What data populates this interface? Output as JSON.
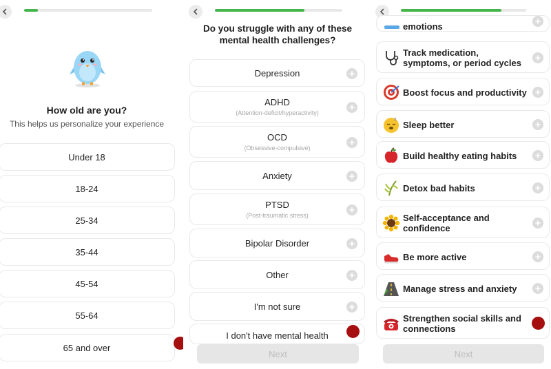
{
  "age_screen": {
    "progress": 0.11,
    "title": "How old are you?",
    "subtitle": "This helps us personalize your experience",
    "options": [
      "Under 18",
      "18-24",
      "25-34",
      "35-44",
      "45-54",
      "55-64",
      "65 and over"
    ]
  },
  "challenges_screen": {
    "progress": 0.7,
    "title_line1": "Do you struggle with any of these",
    "title_line2": "mental health challenges?",
    "options": [
      {
        "label": "Depression",
        "sub": ""
      },
      {
        "label": "ADHD",
        "sub": "(Attention-deficit/hyperactivity)"
      },
      {
        "label": "OCD",
        "sub": "(Obsessive-compulsive)"
      },
      {
        "label": "Anxiety",
        "sub": ""
      },
      {
        "label": "PTSD",
        "sub": "(Post-traumatic stress)"
      },
      {
        "label": "Bipolar Disorder",
        "sub": ""
      },
      {
        "label": "Other",
        "sub": ""
      },
      {
        "label": "I'm not sure",
        "sub": ""
      },
      {
        "label": "I don't have mental health",
        "sub": ""
      }
    ],
    "next_label": "Next"
  },
  "goals_screen": {
    "progress": 0.8,
    "options": [
      {
        "label": "emotions",
        "icon": "partial-icon"
      },
      {
        "label": "Track medication, symptoms, or period cycles",
        "icon": "stethoscope-icon"
      },
      {
        "label": "Boost focus and productivity",
        "icon": "target-icon"
      },
      {
        "label": "Sleep better",
        "icon": "sleepy-face-icon"
      },
      {
        "label": "Build healthy eating habits",
        "icon": "apple-icon"
      },
      {
        "label": "Detox bad habits",
        "icon": "herb-icon"
      },
      {
        "label": "Self-acceptance and confidence",
        "icon": "sunflower-icon"
      },
      {
        "label": "Be more active",
        "icon": "sneaker-icon"
      },
      {
        "label": "Manage stress and anxiety",
        "icon": "road-icon"
      },
      {
        "label": "Strengthen social skills and connections",
        "icon": "telephone-icon"
      }
    ],
    "next_label": "Next"
  },
  "colors": {
    "progress_fill": "#43b549",
    "selected_marker": "#a50f10",
    "card_border": "#e9e9e9"
  }
}
